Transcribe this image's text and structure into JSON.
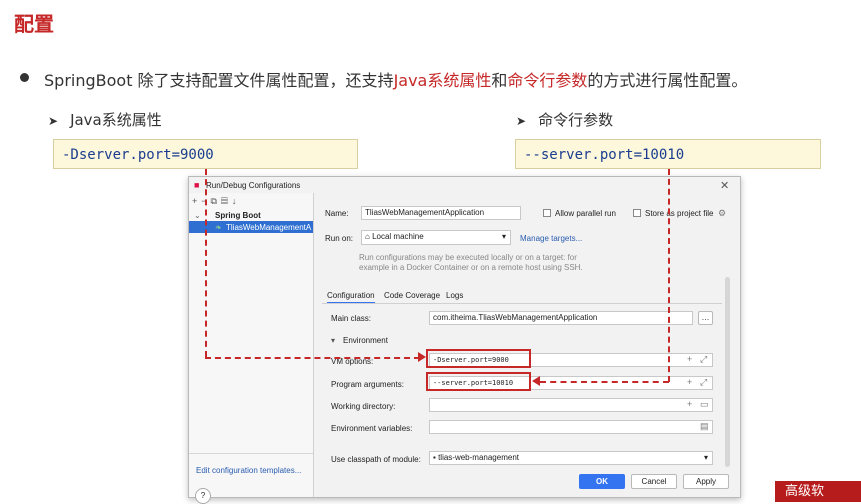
{
  "slide": {
    "title": "配置",
    "bullet": {
      "prefix": "SpringBoot 除了支持配置文件属性配置，还支持",
      "highlight1": "Java系统属性",
      "middle": "和",
      "highlight2": "命令行参数",
      "suffix": "的方式进行属性配置。"
    },
    "left": {
      "heading": "Java系统属性",
      "code": "-Dserver.port=9000"
    },
    "right": {
      "heading": "命令行参数",
      "code": "--server.port=10010"
    },
    "banner": "高级软"
  },
  "dialog": {
    "title": "Run/Debug Configurations",
    "tree": {
      "group": "Spring Boot",
      "item": "TliasWebManagementA"
    },
    "edit_templates": "Edit configuration templates...",
    "name_label": "Name:",
    "name_value": "TliasWebManagementApplication",
    "allow_parallel": "Allow parallel run",
    "store_as_project": "Store as project file",
    "run_on_label": "Run on:",
    "run_on_value": "Local machine",
    "manage_targets": "Manage targets...",
    "run_on_hint": "Run configurations may be executed locally or on a target: for example in a Docker Container or on a remote host using SSH.",
    "tabs": [
      "Configuration",
      "Code Coverage",
      "Logs"
    ],
    "main_class_label": "Main class:",
    "main_class_value": "com.itheima.TliasWebManagementApplication",
    "environment_label": "Environment",
    "vm_options_label": "VM options:",
    "vm_options_value": "-Dserver.port=9000",
    "program_args_label": "Program arguments:",
    "program_args_value": "--server.port=10010",
    "working_dir_label": "Working directory:",
    "env_vars_label": "Environment variables:",
    "classpath_label": "Use classpath of module:",
    "classpath_value": "tlias-web-management",
    "ok": "OK",
    "cancel": "Cancel",
    "apply": "Apply",
    "help": "?"
  }
}
